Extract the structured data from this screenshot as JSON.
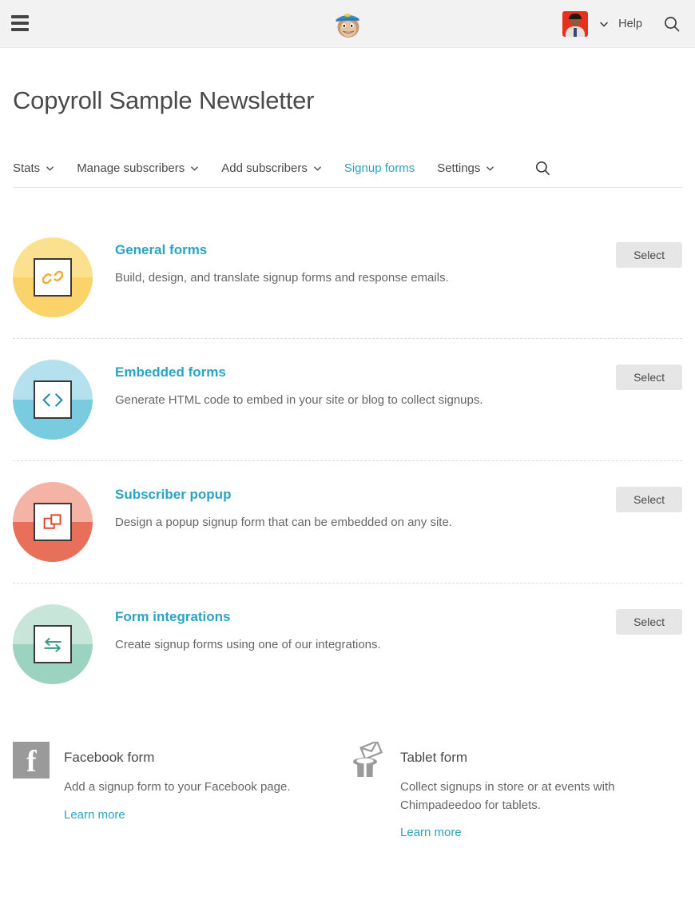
{
  "topbar": {
    "menu_icon": "hamburger-icon",
    "logo_icon": "mailchimp-freddie-logo",
    "avatar_icon": "user-avatar",
    "account_caret_icon": "chevron-down-icon",
    "help_label": "Help",
    "search_icon": "search-icon"
  },
  "header": {
    "title": "Copyroll Sample Newsletter"
  },
  "nav": {
    "items": [
      {
        "label": "Stats",
        "has_caret": true,
        "active": false
      },
      {
        "label": "Manage subscribers",
        "has_caret": true,
        "active": false
      },
      {
        "label": "Add subscribers",
        "has_caret": true,
        "active": false
      },
      {
        "label": "Signup forms",
        "has_caret": false,
        "active": true
      },
      {
        "label": "Settings",
        "has_caret": true,
        "active": false
      }
    ],
    "search_icon": "search-icon"
  },
  "forms": {
    "select_label": "Select",
    "rows": [
      {
        "title": "General forms",
        "description": "Build, design, and translate signup forms and response emails.",
        "icon": "link-chain-icon",
        "circle_top": "#fbe08f",
        "circle_bottom": "#fad36a",
        "glyph_color": "#f5a623"
      },
      {
        "title": "Embedded forms",
        "description": "Generate HTML code to embed in your site or blog to collect signups.",
        "icon": "code-brackets-icon",
        "circle_top": "#b5e0ed",
        "circle_bottom": "#79ccdf",
        "glyph_color": "#2691ad"
      },
      {
        "title": "Subscriber popup",
        "description": "Design a popup signup form that can be embedded on any site.",
        "icon": "popup-windows-icon",
        "circle_top": "#f5b3a6",
        "circle_bottom": "#e8705a",
        "glyph_color": "#e0452a"
      },
      {
        "title": "Form integrations",
        "description": "Create signup forms using one of our integrations.",
        "icon": "two-way-arrows-icon",
        "circle_top": "#c7e6d9",
        "circle_bottom": "#9bd2c0",
        "glyph_color": "#3a9b85"
      }
    ]
  },
  "promos": [
    {
      "title": "Facebook form",
      "description": "Add a signup form to your Facebook page.",
      "link_label": "Learn more",
      "icon": "facebook-icon"
    },
    {
      "title": "Tablet form",
      "description": "Collect signups in store or at events with Chimpadeedoo for tablets.",
      "link_label": "Learn more",
      "icon": "magic-hat-envelope-icon"
    }
  ]
}
